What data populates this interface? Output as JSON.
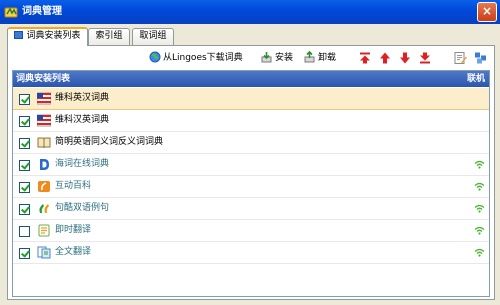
{
  "window": {
    "title": "词典管理",
    "close_glyph": "×"
  },
  "tabs": [
    {
      "label": "词典安装列表",
      "active": true
    },
    {
      "label": "索引组",
      "active": false
    },
    {
      "label": "取词组",
      "active": false
    }
  ],
  "toolbar": {
    "download_label": "从Lingoes下载词典",
    "install_label": "安装",
    "uninstall_label": "卸载"
  },
  "grid": {
    "header_left": "词典安装列表",
    "header_right": "联机",
    "rows": [
      {
        "label": "维科英汉词典",
        "checked": true,
        "selected": true,
        "icon": "us-flag-icon",
        "online": false
      },
      {
        "label": "维科汉英词典",
        "checked": true,
        "selected": false,
        "icon": "us-flag-icon",
        "online": false
      },
      {
        "label": "简明英语同义词反义词词典",
        "checked": true,
        "selected": false,
        "icon": "book-icon",
        "online": false
      },
      {
        "label": "海词在线词典",
        "checked": true,
        "selected": false,
        "icon": "dict-d-icon",
        "online": true
      },
      {
        "label": "互动百科",
        "checked": true,
        "selected": false,
        "icon": "hudong-icon",
        "online": true
      },
      {
        "label": "句酷双语例句",
        "checked": true,
        "selected": false,
        "icon": "jukuu-icon",
        "online": true
      },
      {
        "label": "即时翻译",
        "checked": false,
        "selected": false,
        "icon": "translate-icon",
        "online": true
      },
      {
        "label": "全文翻译",
        "checked": true,
        "selected": false,
        "icon": "fulltext-translate-icon",
        "online": true
      }
    ]
  },
  "colors": {
    "accent": "#0a5fe8",
    "header": "#2b56ab",
    "selected_row": "#fdeecb",
    "online": "#46b82e"
  }
}
